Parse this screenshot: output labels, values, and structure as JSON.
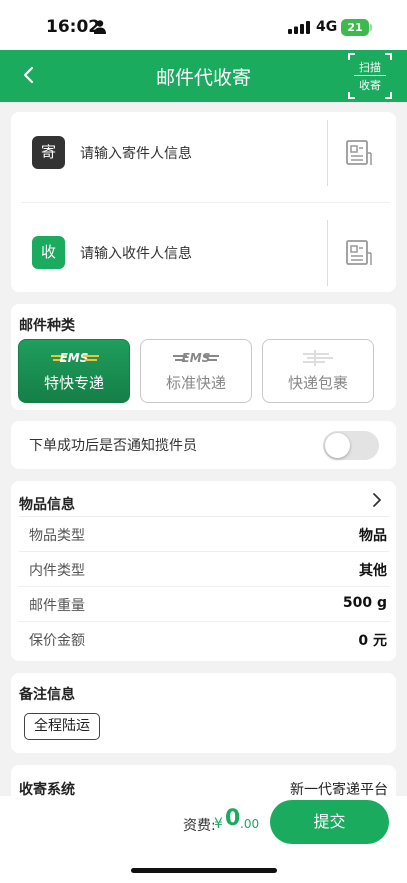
{
  "status": {
    "time": "16:02",
    "network": "4G",
    "battery": "21"
  },
  "nav": {
    "title": "邮件代收寄",
    "scan_top": "扫描",
    "scan_bottom": "收寄"
  },
  "address": {
    "sender_badge": "寄",
    "sender_placeholder": "请输入寄件人信息",
    "receiver_badge": "收",
    "receiver_placeholder": "请输入收件人信息"
  },
  "mail_type": {
    "title": "邮件种类",
    "options": [
      {
        "label": "特快专递",
        "logo": "EMS",
        "selected": true
      },
      {
        "label": "标准快递",
        "logo": "EMS",
        "selected": false
      },
      {
        "label": "快递包裹",
        "logo": "",
        "selected": false
      }
    ]
  },
  "notify": {
    "label": "下单成功后是否通知揽件员",
    "enabled": false
  },
  "goods": {
    "title": "物品信息",
    "rows": [
      {
        "label": "物品类型",
        "value": "物品"
      },
      {
        "label": "内件类型",
        "value": "其他"
      },
      {
        "label": "邮件重量",
        "value": "500 g"
      },
      {
        "label": "保价金额",
        "value": "0 元"
      }
    ]
  },
  "remark": {
    "title": "备注信息",
    "tag": "全程陆运"
  },
  "system": {
    "label": "收寄系统",
    "value": "新一代寄递平台"
  },
  "footer": {
    "fee_label": "资费:",
    "currency": "¥",
    "amount_int": "0",
    "amount_dec": ".00",
    "submit": "提交"
  },
  "colors": {
    "primary": "#1aab5f",
    "sender_badge": "#333333",
    "receiver_badge": "#1aab5f"
  }
}
